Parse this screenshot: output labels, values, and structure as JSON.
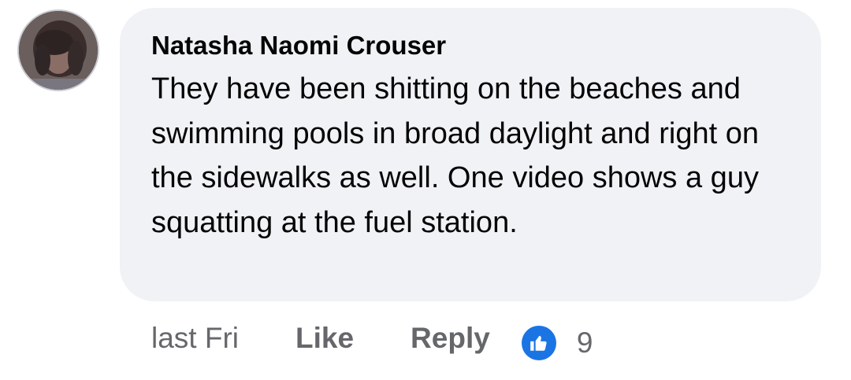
{
  "comment": {
    "author": "Natasha Naomi Crouser",
    "text": "They have been shitting on the beaches and swimming pools in broad daylight and right on the sidewalks as well. One video shows a guy squatting at the fuel station.",
    "timestamp": "last Fri",
    "like_label": "Like",
    "reply_label": "Reply",
    "reaction_icon": "thumbs-up-icon",
    "reaction_count": "9"
  },
  "colors": {
    "bubble_background": "#f0f2f5",
    "text_primary": "#050505",
    "text_secondary": "#65676b",
    "reaction_blue": "#1b74e4"
  }
}
